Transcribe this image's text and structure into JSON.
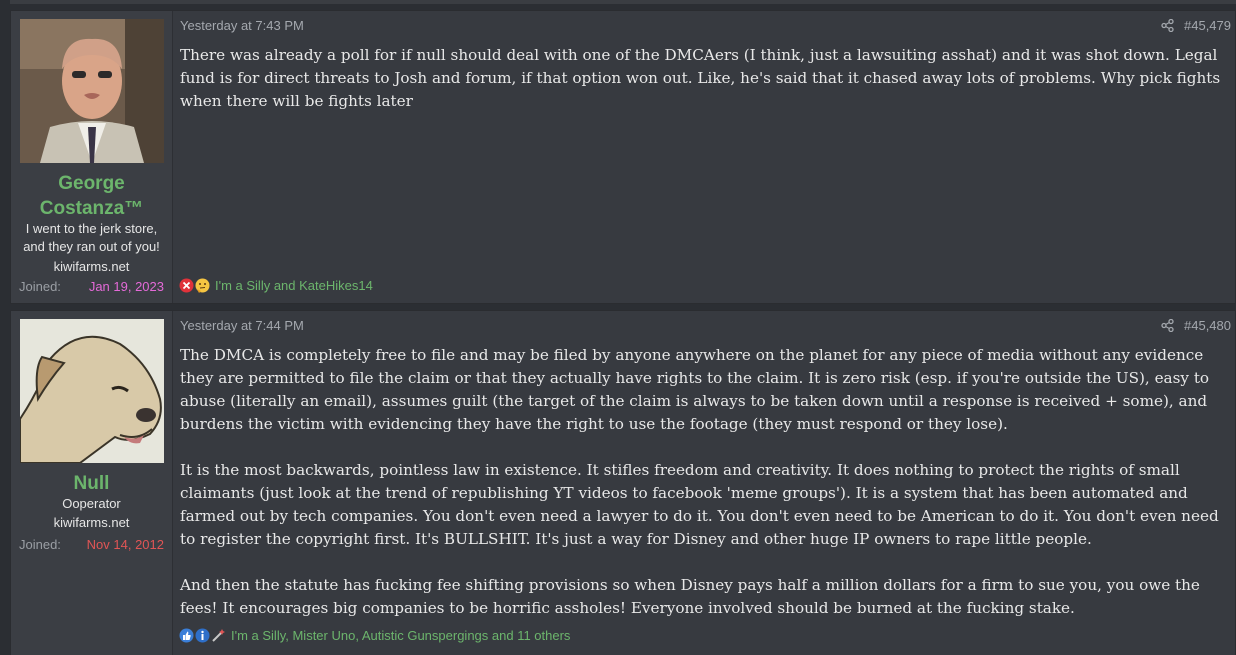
{
  "posts": [
    {
      "date": "Yesterday at 7:43 PM",
      "number": "#45,479",
      "user": {
        "name_line1": "George",
        "name_line2": "Costanza™",
        "title_line1": "I went to the jerk store,",
        "title_line2": "and they ran out of you!",
        "site": "kiwifarms.net",
        "joined_label": "Joined:",
        "joined_date": "Jan 19, 2023"
      },
      "body": [
        "There was already a poll for if null should deal with one of the DMCAers (I think, just a lawsuiting asshat) and it was shot down. Legal fund is for direct threats to Josh and forum, if that option won out. Like, he's said that it chased away lots of problems. Why pick fights when there will be fights later"
      ],
      "reactions": {
        "icons": [
          "x-circle-icon",
          "thinking-face-icon"
        ],
        "text": "I'm a Silly and KateHikes14"
      }
    },
    {
      "date": "Yesterday at 7:44 PM",
      "number": "#45,480",
      "user": {
        "name": "Null",
        "title": "Ooperator",
        "site": "kiwifarms.net",
        "joined_label": "Joined:",
        "joined_date": "Nov 14, 2012"
      },
      "body": [
        "The DMCA is completely free to file and may be filed by anyone anywhere on the planet for any piece of media without any evidence they are permitted to file the claim or that they actually have rights to the claim. It is zero risk (esp. if you're outside the US), easy to abuse (literally an email), assumes guilt (the target of the claim is always to be taken down until a response is received + some), and burdens the victim with evidencing they have the right to use the footage (they must respond or they lose).",
        "It is the most backwards, pointless law in existence. It stifles freedom and creativity. It does nothing to protect the rights of small claimants (just look at the trend of republishing YT videos to facebook 'meme groups'). It is a system that has been automated and farmed out by tech companies. You don't even need a lawyer to do it. You don't even need to be American to do it. You don't even need to register the copyright first. It's BULLSHIT. It's just a way for Disney and other huge IP owners to rape little people.",
        "And then the statute has fucking fee shifting provisions so when Disney pays half a million dollars for a firm to sue you, you owe the fees! It encourages big companies to be horrific assholes! Everyone involved should be burned at the fucking stake."
      ],
      "reactions": {
        "icons": [
          "thumbs-up-icon",
          "info-icon",
          "wand-icon"
        ],
        "text": "I'm a Silly, Mister Uno, Autistic Gunspergings and 11 others"
      }
    }
  ],
  "colors": {
    "username": "#6cb56c",
    "joined_date_1": "#e46ad8",
    "joined_date_2": "#e05555",
    "reaction_text": "#6cb56c"
  }
}
